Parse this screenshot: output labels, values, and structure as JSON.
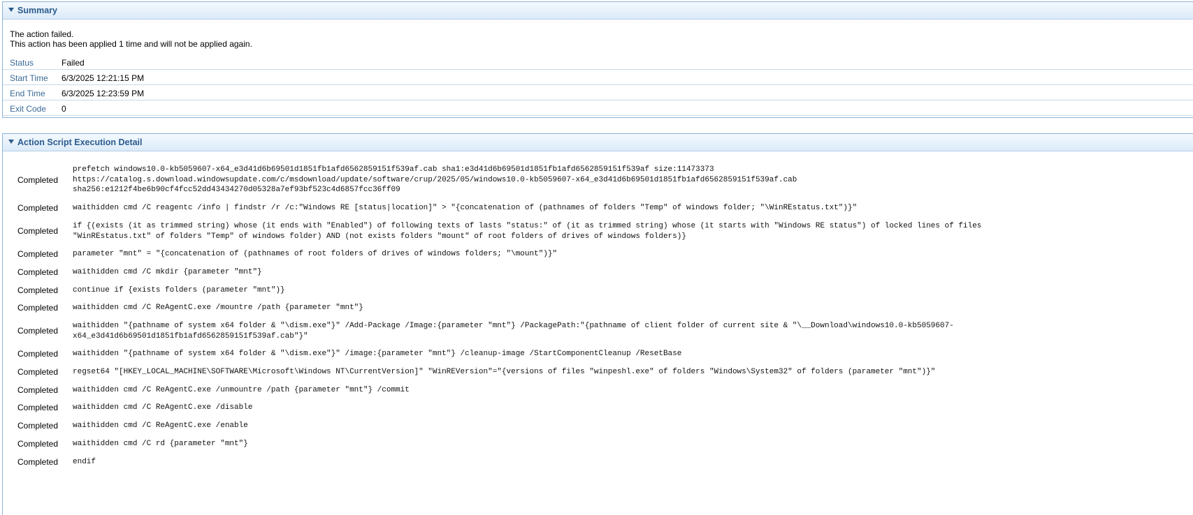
{
  "summary": {
    "title": "Summary",
    "message_line1": "The action failed.",
    "message_line2": "This action has been applied 1 time and will not be applied again.",
    "fields": [
      {
        "label": "Status",
        "value": "Failed"
      },
      {
        "label": "Start Time",
        "value": "6/3/2025 12:21:15 PM"
      },
      {
        "label": "End Time",
        "value": "6/3/2025 12:23:59 PM"
      },
      {
        "label": "Exit Code",
        "value": "0"
      }
    ]
  },
  "detail": {
    "title": "Action Script Execution Detail",
    "rows": [
      {
        "status": "Completed",
        "command": "prefetch windows10.0-kb5059607-x64_e3d41d6b69501d1851fb1afd6562859151f539af.cab sha1:e3d41d6b69501d1851fb1afd6562859151f539af size:11473373\nhttps://catalog.s.download.windowsupdate.com/c/msdownload/update/software/crup/2025/05/windows10.0-kb5059607-x64_e3d41d6b69501d1851fb1afd6562859151f539af.cab\nsha256:e1212f4be6b90cf4fcc52dd43434270d05328a7ef93bf523c4d6857fcc36ff09"
      },
      {
        "status": "Completed",
        "command": "waithidden cmd /C reagentc /info | findstr /r /c:\"Windows RE [status|location]\" > \"{concatenation of (pathnames of folders \"Temp\" of windows folder; \"\\WinREstatus.txt\")}\""
      },
      {
        "status": "Completed",
        "command": "if {(exists (it as trimmed string) whose (it ends with \"Enabled\") of following texts of lasts \"status:\" of (it as trimmed string) whose (it starts with \"Windows RE status\") of locked lines of files\n\"WinREstatus.txt\" of folders \"Temp\" of windows folder) AND (not exists folders \"mount\" of root folders of drives of windows folders)}"
      },
      {
        "status": "Completed",
        "command": "parameter \"mnt\" = \"{concatenation of (pathnames of root folders of drives of windows folders; \"\\mount\")}\""
      },
      {
        "status": "Completed",
        "command": "waithidden cmd /C mkdir {parameter \"mnt\"}"
      },
      {
        "status": "Completed",
        "command": "continue if {exists folders (parameter \"mnt\")}"
      },
      {
        "status": "Completed",
        "command": "waithidden cmd /C ReAgentC.exe /mountre /path {parameter \"mnt\"}"
      },
      {
        "status": "Completed",
        "command": "waithidden \"{pathname of system x64 folder & \"\\dism.exe\"}\" /Add-Package /Image:{parameter \"mnt\"} /PackagePath:\"{pathname of client folder of current site & \"\\__Download\\windows10.0-kb5059607-\nx64_e3d41d6b69501d1851fb1afd6562859151f539af.cab\"}\""
      },
      {
        "status": "Completed",
        "command": "waithidden \"{pathname of system x64 folder & \"\\dism.exe\"}\" /image:{parameter \"mnt\"} /cleanup-image /StartComponentCleanup /ResetBase"
      },
      {
        "status": "Completed",
        "command": "regset64 \"[HKEY_LOCAL_MACHINE\\SOFTWARE\\Microsoft\\Windows NT\\CurrentVersion]\" \"WinREVersion\"=\"{versions of files \"winpeshl.exe\" of folders \"Windows\\System32\" of folders (parameter \"mnt\")}\""
      },
      {
        "status": "Completed",
        "command": "waithidden cmd /C ReAgentC.exe /unmountre /path {parameter \"mnt\"} /commit"
      },
      {
        "status": "Completed",
        "command": "waithidden cmd /C ReAgentC.exe /disable"
      },
      {
        "status": "Completed",
        "command": "waithidden cmd /C ReAgentC.exe /enable"
      },
      {
        "status": "Completed",
        "command": "waithidden cmd /C rd {parameter \"mnt\"}"
      },
      {
        "status": "Completed",
        "command": "endif"
      }
    ]
  }
}
